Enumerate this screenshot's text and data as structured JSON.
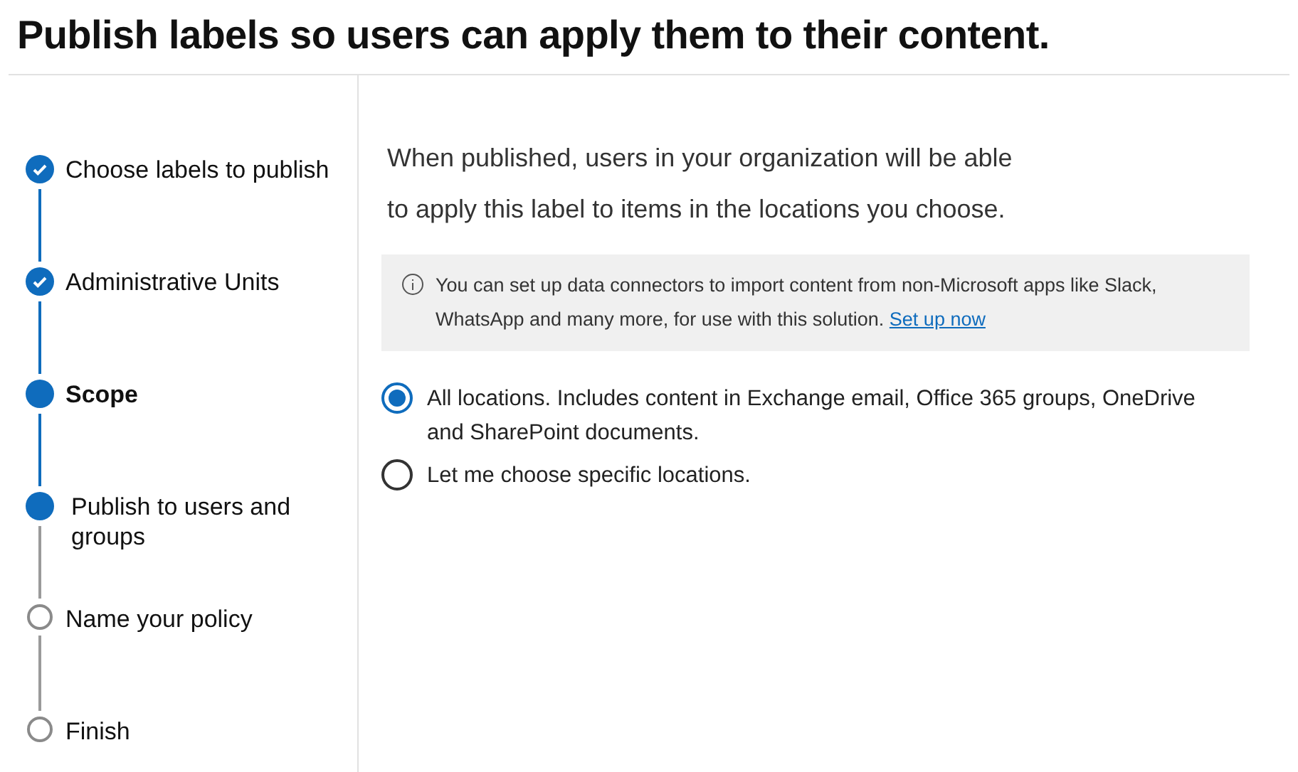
{
  "title": "Publish labels so users can apply them to their content.",
  "steps": [
    {
      "label": "Choose labels to publish",
      "kind": "done"
    },
    {
      "label": "Administrative Units",
      "kind": "done"
    },
    {
      "label": "Scope",
      "kind": "current"
    },
    {
      "label": "Publish to users and groups",
      "kind": "filled"
    },
    {
      "label": "Name your policy",
      "kind": "pending"
    },
    {
      "label": "Finish",
      "kind": "pending"
    }
  ],
  "intro_lines": [
    "When published, users in your organization will be able",
    "to apply this label to items in the locations you choose."
  ],
  "info": {
    "text": "You can set up data connectors to import content from non-Microsoft apps like Slack, WhatsApp and many more, for use with this solution.",
    "link": "Set up now"
  },
  "options": [
    {
      "label": "All locations. Includes content in Exchange email, Office 365 groups, OneDrive and SharePoint documents.",
      "selected": true
    },
    {
      "label": "Let me choose specific locations.",
      "selected": false
    }
  ]
}
